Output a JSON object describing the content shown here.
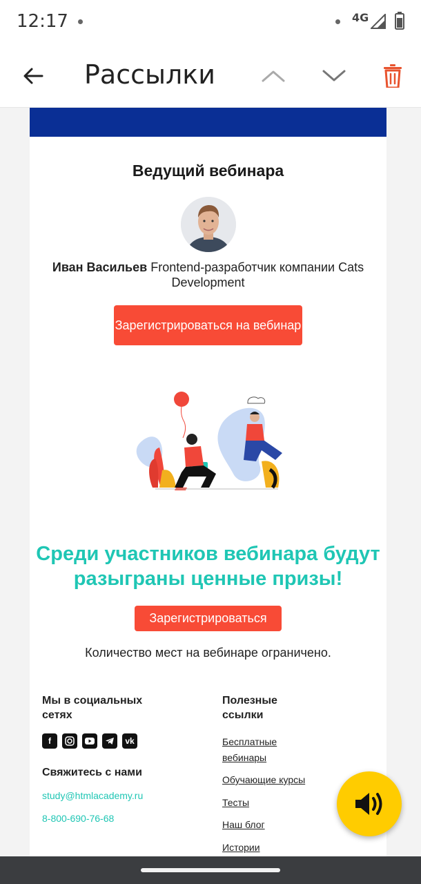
{
  "status_bar": {
    "time": "12:17",
    "network": "4G"
  },
  "app_bar": {
    "title": "Рассылки",
    "back_icon": "arrow-left-icon",
    "prev_icon": "chevron-up-icon",
    "next_icon": "chevron-down-icon",
    "delete_icon": "trash-icon",
    "delete_color": "#e8532e"
  },
  "email": {
    "banner_color": "#0a2f95",
    "host_heading": "Ведущий вебинара",
    "host_name": "Иван Васильев",
    "host_role": "Frontend-разработчик компании Cats Development",
    "register_webinar_label": "Зарегистрироваться на вебинар",
    "promo_text": "Среди участников вебинара будут разыграны ценные призы!",
    "register_label": "Зарегистрироваться",
    "limit_text": "Количество мест на вебинаре ограничено.",
    "accent_color": "#1fc6b4",
    "button_color": "#f84b36"
  },
  "footer": {
    "social_heading": "Мы в социальных сетях",
    "social_icons": [
      "facebook-icon",
      "instagram-icon",
      "youtube-icon",
      "telegram-icon",
      "vk-icon"
    ],
    "contact_heading": "Свяжитесь с нами",
    "email": "study@htmlacademy.ru",
    "phone": "8-800-690-76-68",
    "links_heading": "Полезные ссылки",
    "links": [
      "Бесплатные вебинары",
      "Обучающие курсы",
      "Тесты",
      "Наш блог",
      "Истории"
    ]
  },
  "fab": {
    "icon": "speaker-icon",
    "color": "#ffcc00"
  }
}
